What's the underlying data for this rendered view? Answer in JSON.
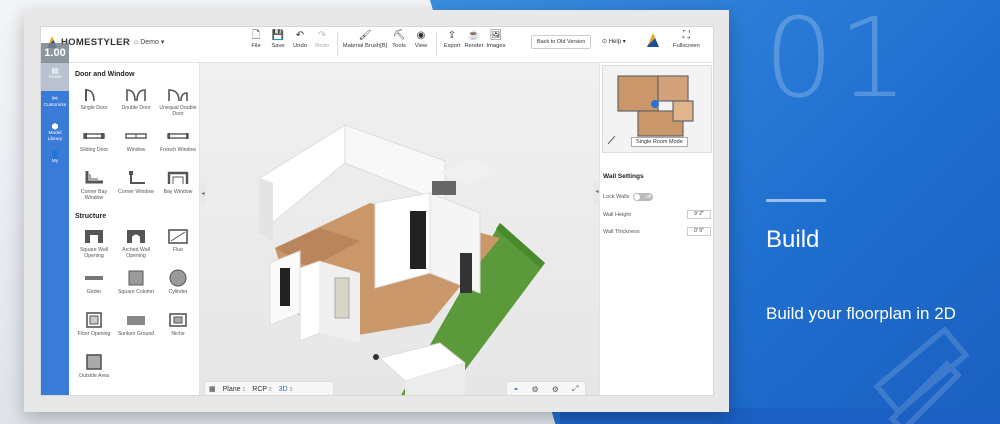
{
  "slide": {
    "number": "01",
    "title": "Build",
    "subtitle": "Build your floorplan in 2D"
  },
  "app": {
    "brand": "HOMESTYLER",
    "project": "Demo",
    "toolbar": [
      {
        "label": "File",
        "icon": "file-icon"
      },
      {
        "label": "Save",
        "icon": "save-icon"
      },
      {
        "label": "Undo",
        "icon": "undo-icon"
      },
      {
        "label": "Redo",
        "icon": "redo-icon",
        "disabled": true
      },
      {
        "label": "Material Brush[B]",
        "icon": "brush-icon"
      },
      {
        "label": "Tools",
        "icon": "tools-icon"
      },
      {
        "label": "View",
        "icon": "eye-icon"
      },
      {
        "label": "Export",
        "icon": "export-icon"
      },
      {
        "label": "Render",
        "icon": "render-icon"
      },
      {
        "label": "Images",
        "icon": "images-icon"
      }
    ],
    "old_version": "Back to Old Version",
    "help": "Help",
    "fullscreen": "Fullscreen",
    "badge": "1.00"
  },
  "sidebar": {
    "items": [
      {
        "label": "Room",
        "icon": "room-icon"
      },
      {
        "label": "Customize",
        "icon": "customize-icon"
      },
      {
        "label": "Model Library",
        "icon": "model-library-icon"
      },
      {
        "label": "My",
        "icon": "user-icon"
      }
    ]
  },
  "catalog": {
    "door_window_title": "Door and Window",
    "door_window": [
      {
        "label": "Single Door",
        "icon": "single-door-icon"
      },
      {
        "label": "Double Door",
        "icon": "double-door-icon"
      },
      {
        "label": "Unequal Double Door",
        "icon": "unequal-double-door-icon"
      },
      {
        "label": "Sliding Door",
        "icon": "sliding-door-icon"
      },
      {
        "label": "Window",
        "icon": "window-icon"
      },
      {
        "label": "French Window",
        "icon": "french-window-icon"
      },
      {
        "label": "Corner Bay Window",
        "icon": "corner-bay-window-icon"
      },
      {
        "label": "Corner Window",
        "icon": "corner-window-icon"
      },
      {
        "label": "Bay Window",
        "icon": "bay-window-icon"
      }
    ],
    "structure_title": "Structure",
    "structure": [
      {
        "label": "Square Wall Opening",
        "icon": "square-wall-opening-icon"
      },
      {
        "label": "Arched Wall Opening",
        "icon": "arched-wall-opening-icon"
      },
      {
        "label": "Flue",
        "icon": "flue-icon"
      },
      {
        "label": "Girder",
        "icon": "girder-icon"
      },
      {
        "label": "Square Column",
        "icon": "square-column-icon"
      },
      {
        "label": "Cylinder",
        "icon": "cylinder-icon"
      },
      {
        "label": "Floor Opening",
        "icon": "floor-opening-icon"
      },
      {
        "label": "Sunken Ground",
        "icon": "sunken-ground-icon"
      },
      {
        "label": "Niche",
        "icon": "niche-icon"
      },
      {
        "label": "Outside Area",
        "icon": "outside-area-icon"
      }
    ]
  },
  "viewport": {
    "tabs": [
      {
        "label": "Plane",
        "key": "1"
      },
      {
        "label": "RCP",
        "key": "2"
      },
      {
        "label": "3D",
        "key": "3",
        "active": true
      }
    ]
  },
  "right_panel": {
    "single_room": "Single Room Mode",
    "wall_settings_title": "Wall Settings",
    "lock_walls_label": "Lock Walls",
    "lock_walls_state": "Off",
    "wall_height_label": "Wall Height",
    "wall_height_value": "9' 2\"",
    "wall_thickness_label": "Wall Thickness",
    "wall_thickness_value": "0' 9\""
  },
  "colors": {
    "accent_blue": "#3a7ad9",
    "slide_blue": "#2a7ad8",
    "grass": "#5a9a3a",
    "floor_wood": "#c9976a"
  }
}
